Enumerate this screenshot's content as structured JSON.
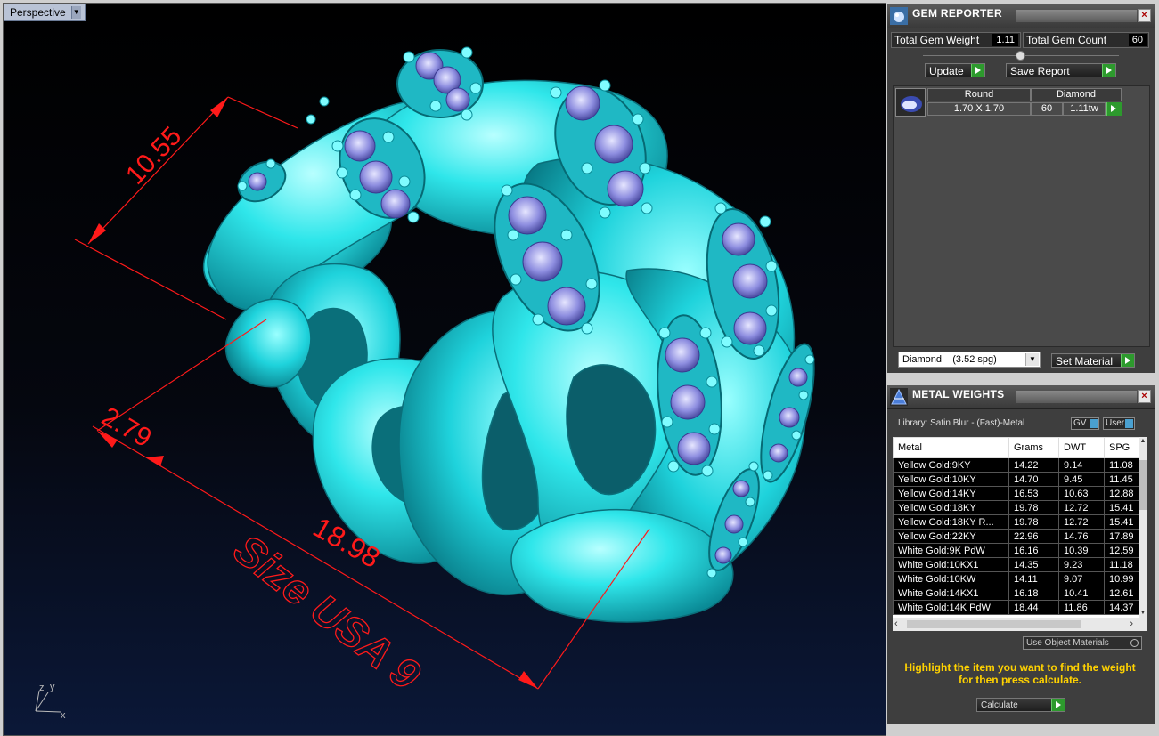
{
  "viewport": {
    "name": "Perspective",
    "dimensions": [
      "10.55",
      "2.79",
      "18.98"
    ],
    "size_label": "Size USA 9",
    "axis_labels": {
      "x": "x",
      "y": "y",
      "z": "z"
    }
  },
  "gem_reporter": {
    "title": "GEM REPORTER",
    "close": "×",
    "total_weight_label": "Total Gem Weight",
    "total_weight_value": "1.11",
    "total_count_label": "Total Gem Count",
    "total_count_value": "60",
    "update_label": "Update",
    "save_report_label": "Save Report",
    "gem": {
      "shape": "Round",
      "material": "Diamond",
      "size": "1.70 X 1.70",
      "count": "60",
      "weight": "1.11tw"
    },
    "material_select": "Diamond    (3.52 spg)",
    "set_material_label": "Set Material"
  },
  "metal_weights": {
    "title": "METAL WEIGHTS",
    "close": "×",
    "library": "Library: Satin Blur - (Fast)-Metal",
    "gv_label": "GV",
    "user_label": "User",
    "headers": [
      "Metal",
      "Grams",
      "DWT",
      "SPG"
    ],
    "rows": [
      [
        "Yellow Gold:9KY",
        "14.22",
        "9.14",
        "11.08"
      ],
      [
        "Yellow Gold:10KY",
        "14.70",
        "9.45",
        "11.45"
      ],
      [
        "Yellow Gold:14KY",
        "16.53",
        "10.63",
        "12.88"
      ],
      [
        "Yellow Gold:18KY",
        "19.78",
        "12.72",
        "15.41"
      ],
      [
        "Yellow Gold:18KY R...",
        "19.78",
        "12.72",
        "15.41"
      ],
      [
        "Yellow Gold:22KY",
        "22.96",
        "14.76",
        "17.89"
      ],
      [
        "White Gold:9K PdW",
        "16.16",
        "10.39",
        "12.59"
      ],
      [
        "White Gold:10KX1",
        "14.35",
        "9.23",
        "11.18"
      ],
      [
        "White Gold:10KW",
        "14.11",
        "9.07",
        "10.99"
      ],
      [
        "White Gold:14KX1",
        "16.18",
        "10.41",
        "12.61"
      ],
      [
        "White Gold:14K PdW",
        "18.44",
        "11.86",
        "14.37"
      ]
    ],
    "use_object_materials": "Use Object Materials",
    "hint": "Highlight the item you want to find the weight for then press calculate.",
    "calculate_label": "Calculate"
  }
}
